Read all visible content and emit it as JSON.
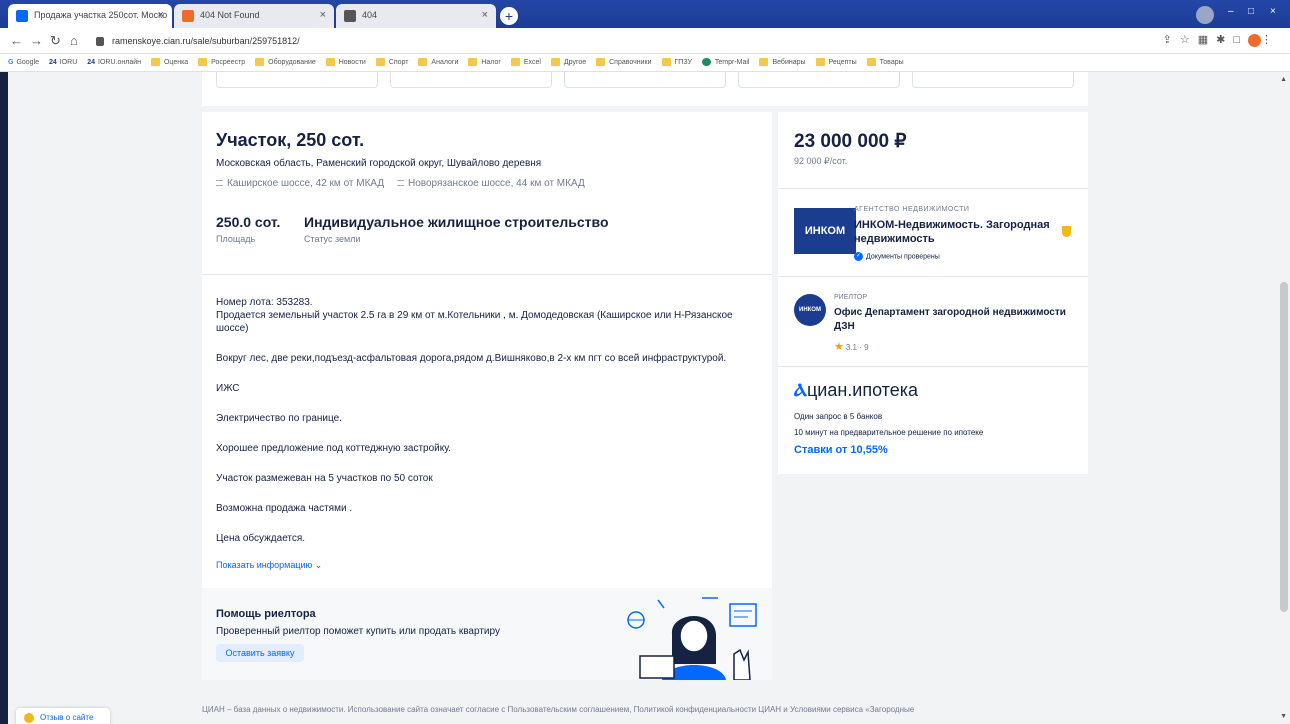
{
  "browser": {
    "tabs": [
      {
        "title": "Продажа участка 250сот. Моско",
        "favicon_color": "#0468ff"
      },
      {
        "title": "404 Not Found",
        "favicon_color": "#f06a2c"
      },
      {
        "title": "404",
        "favicon_color": "#555555"
      }
    ],
    "new_tab": "+",
    "window_controls": {
      "minimize": "–",
      "maximize": "□",
      "close": "×"
    },
    "url": "ramenskoye.cian.ru/sale/suburban/259751812/",
    "bookmarks": [
      "Google",
      "IORU",
      "IORU.онлайн",
      "Оценка",
      "Росреестр",
      "Оборудование",
      "Новости",
      "Спорт",
      "Аналоги",
      "Налог",
      "Excel",
      "Другое",
      "Справочники",
      "ГПЗУ",
      "Tempr-Mail",
      "Вебинары",
      "Рецепты",
      "Товары"
    ]
  },
  "listing": {
    "title": "Участок, 250 сот.",
    "address": "Московская область, Раменский городской округ, Шувайлово деревня",
    "highways": [
      "Каширское шоссе, 42 км от МКАД",
      "Новорязанское шоссе, 44 км от МКАД"
    ],
    "area_value": "250.0 сот.",
    "area_label": "Площадь",
    "status_value": "Индивидуальное жилищное строительство",
    "status_label": "Статус земли",
    "description": [
      "Номер лота: 353283.\nПродается земельный участок 2.5 га в 29 км от м.Котельники , м. Домодедовская (Каширское или Н-Рязанское шоссе)",
      "Вокруг лес, две реки,подъезд-асфальтовая дорога,рядом д.Вишняково,в 2-х км пгт со всей инфраструктурой.",
      "ИЖС",
      "Электричество по границе.",
      "Хорошее предложение под коттеджную застройку.",
      "Участок размежеван на 5 участков по 50 соток",
      "Возможна продажа частями .",
      "Цена обсуждается."
    ],
    "show_more": "Показать информацию ⌄"
  },
  "help": {
    "title": "Помощь риелтора",
    "text": "Проверенный риелтор поможет купить или продать квартиру",
    "button": "Оставить заявку"
  },
  "sidebar": {
    "price": "23 000 000 ₽",
    "price_per": "92 000 ₽/сот.",
    "agency": {
      "logo": "ИНКОМ",
      "kind": "АГЕНТСТВО НЕДВИЖИМОСТИ",
      "name": "ИНКОМ-Недвижимость. Загородная недвижимость",
      "verified": "Документы проверены"
    },
    "realtor": {
      "logo": "ИНКОМ",
      "kind": "РИЕЛТОР",
      "name": "Офис Департамент загородной недвижимости ДЗН",
      "rating": "3.1 · 9"
    },
    "mortgage": {
      "logo_pin": "Ⲁ",
      "logo_text": "циан.ипотека",
      "line1": "Один запрос в 5 банков",
      "line2": "10 минут на предварительное решение по ипотеке",
      "rate": "Ставки от 10,55%"
    }
  },
  "footer": {
    "text": "ЦИАН – база данных о недвижимости. Использование сайта означает согласие с Пользовательским соглашением, Политикой конфиденциальности ЦИАН и Условиями сервиса «Загородные"
  },
  "feedback": "Отзыв о сайте"
}
